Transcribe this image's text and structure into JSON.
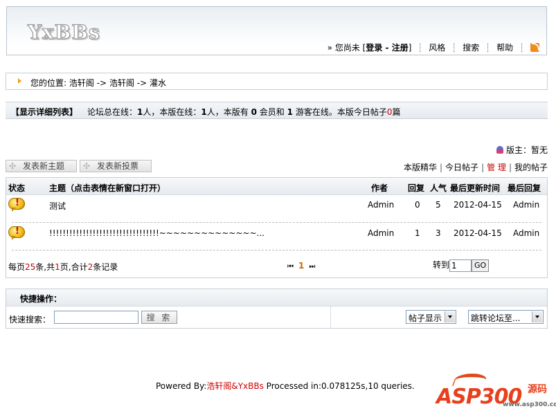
{
  "header": {
    "logo": "YxBBs",
    "guest_prefix": "» 您尚未",
    "login": "登录",
    "dash": "-",
    "register": "注册",
    "style": "风格",
    "search": "搜索",
    "help": "帮助",
    "rss_icon": "rss-icon"
  },
  "breadcrumb": {
    "prefix": "您的位置:",
    "path": [
      "浩轩阁",
      "浩轩阁",
      "灌水"
    ],
    "arrow": "->"
  },
  "online": {
    "show_list": "【显示详细列表】",
    "stats_a": "论坛总在线：",
    "total": "1",
    "stats_b": "人，本版在线：",
    "board": "1",
    "stats_c": "人，本版有",
    "members": "0",
    "stats_d": "会员和",
    "guests": "1",
    "stats_e": "游客在线。本版今日帖子",
    "today": "0",
    "stats_f": "篇"
  },
  "moderator": {
    "label": "版主：",
    "value": "暂无"
  },
  "actions": {
    "new_topic": "发表新主题",
    "new_poll": "发表新投票"
  },
  "tabs": [
    "本版精华",
    "今日帖子",
    "管 理",
    "我的帖子"
  ],
  "table": {
    "columns": [
      "状态",
      "主题（点击表情在新窗口打开）",
      "作者",
      "回复",
      "人气",
      "最后更新时间",
      "最后回复"
    ],
    "rows": [
      {
        "title": "测试",
        "author": "Admin",
        "replies": "0",
        "views": "5",
        "updated": "2012-04-15",
        "last": "Admin"
      },
      {
        "title": "!!!!!!!!!!!!!!!!!!!!!!!!!!!!!!!!!~~~~~~~~~~~~~~...",
        "author": "Admin",
        "replies": "1",
        "views": "3",
        "updated": "2012-04-15",
        "last": "Admin"
      }
    ]
  },
  "pager": {
    "per_page_a": "每页",
    "per_page": "25",
    "per_page_b": "条,共",
    "pages": "1",
    "per_page_c": "页,合计",
    "total": "2",
    "per_page_d": "条记录",
    "current": "1",
    "goto_label": "转到",
    "goto_value": "1",
    "go": "GO"
  },
  "quick": {
    "title": "快捷操作：",
    "search_label": "快速搜索：",
    "search_btn": "搜 索",
    "display_select": "帖子显示",
    "jump_select": "跳转论坛至..."
  },
  "footer": {
    "powered": "Powered By:",
    "brand": "浩轩阁&YxBBs",
    "processed": " Processed in:0.078125s,10 queries."
  },
  "watermark": {
    "main": "ASP300",
    "side": "源码",
    "url": "www.asp300.com"
  }
}
